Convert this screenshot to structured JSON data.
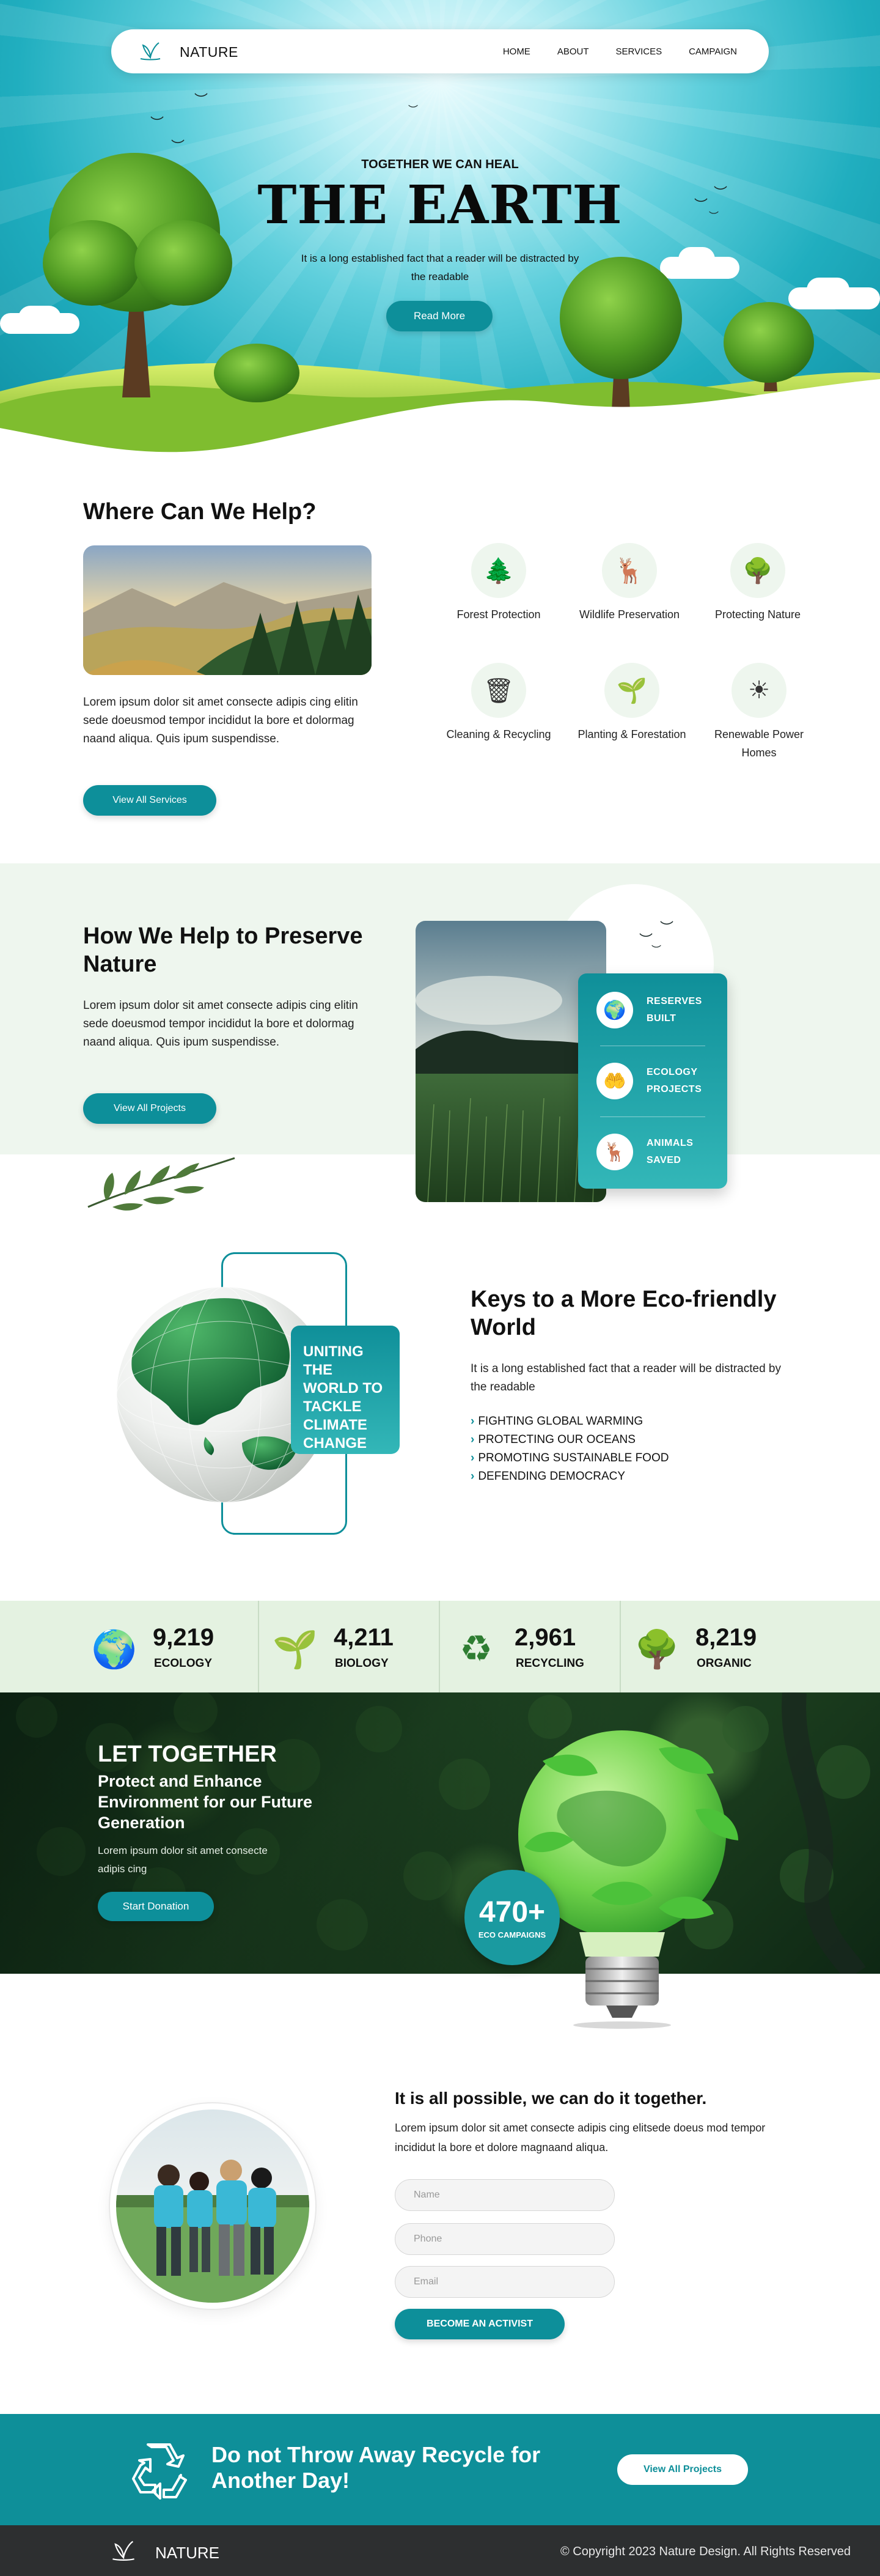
{
  "nav": {
    "brand": "NATURE",
    "items": [
      "HOME",
      "ABOUT",
      "SERVICES",
      "CAMPAIGN"
    ]
  },
  "hero": {
    "kicker": "TOGETHER WE CAN HEAL",
    "title": "THE EARTH",
    "subtitle": "It is a long established fact that a reader will be distracted by the readable",
    "cta": "Read More"
  },
  "help": {
    "title": "Where Can We Help?",
    "paragraph": "Lorem ipsum dolor sit amet consecte adipis cing elitin sede doeusmod tempor incididut la bore et dolormag naand aliqua. Quis ipum suspendisse.",
    "cta": "View All Services",
    "services": [
      {
        "label": "Forest Protection",
        "icon": "forest-icon"
      },
      {
        "label": "Wildlife Preservation",
        "icon": "deer-icon"
      },
      {
        "label": "Protecting Nature",
        "icon": "hand-tree-icon"
      },
      {
        "label": "Cleaning & Recycling",
        "icon": "recycle-bin-icon"
      },
      {
        "label": "Planting & Forestation",
        "icon": "sprout-icon"
      },
      {
        "label": "Renewable Power Homes",
        "icon": "solar-panel-icon"
      }
    ]
  },
  "preserve": {
    "title": "How We Help to Preserve Nature",
    "paragraph": "Lorem ipsum dolor sit amet consecte adipis cing elitin sede doeusmod tempor incididut la bore et dolormag naand aliqua. Quis ipum suspendisse.",
    "cta": "View All Projects",
    "stats": [
      {
        "label_line1": "RESERVES",
        "label_line2": "BUILT",
        "icon": "globe-icon"
      },
      {
        "label_line1": "ECOLOGY",
        "label_line2": "PROJECTS",
        "icon": "hand-leaf-icon"
      },
      {
        "label_line1": "ANIMALS",
        "label_line2": "SAVED",
        "icon": "deer-icon"
      }
    ]
  },
  "keys": {
    "badge": "UNITING THE WORLD TO TACKLE CLIMATE CHANGE",
    "title": "Keys to a More Eco-friendly World",
    "paragraph": "It is a long established fact that a reader will be distracted by the readable",
    "list": [
      "FIGHTING GLOBAL WARMING",
      "PROTECTING OUR OCEANS",
      "PROMOTING SUSTAINABLE FOOD",
      "DEFENDING DEMOCRACY"
    ]
  },
  "counters": [
    {
      "value": "9,219",
      "label": "ECOLOGY",
      "icon": "earth-icon"
    },
    {
      "value": "4,211",
      "label": "BIOLOGY",
      "icon": "seedling-icon"
    },
    {
      "value": "2,961",
      "label": "RECYCLING",
      "icon": "recycle-icon"
    },
    {
      "value": "8,219",
      "label": "ORGANIC",
      "icon": "trees-icon"
    }
  ],
  "together": {
    "title": "LET TOGETHER",
    "subtitle": "Protect and Enhance Environment for our Future Generation",
    "paragraph": "Lorem ipsum dolor sit amet consecte adipis cing",
    "cta": "Start Donation",
    "badge_value": "470+",
    "badge_label": "ECO CAMPAIGNS"
  },
  "activist": {
    "title": "It is all possible, we can do it together.",
    "paragraph": "Lorem ipsum dolor sit amet consecte adipis cing elitsede doeus mod tempor incididut la bore et dolore magnaand aliqua.",
    "fields": {
      "name": "Name",
      "phone": "Phone",
      "email": "Email"
    },
    "cta": "BECOME AN ACTIVIST"
  },
  "recycle": {
    "title": "Do not Throw Away Recycle for Another Day!",
    "cta": "View All Projects"
  },
  "footer": {
    "brand": "NATURE",
    "copyright": "© Copyright 2023 Nature Design. All Rights Reserved"
  },
  "colors": {
    "accent": "#0d8f9a",
    "light_green": "#eef6ee",
    "footer": "#2d2f30"
  }
}
